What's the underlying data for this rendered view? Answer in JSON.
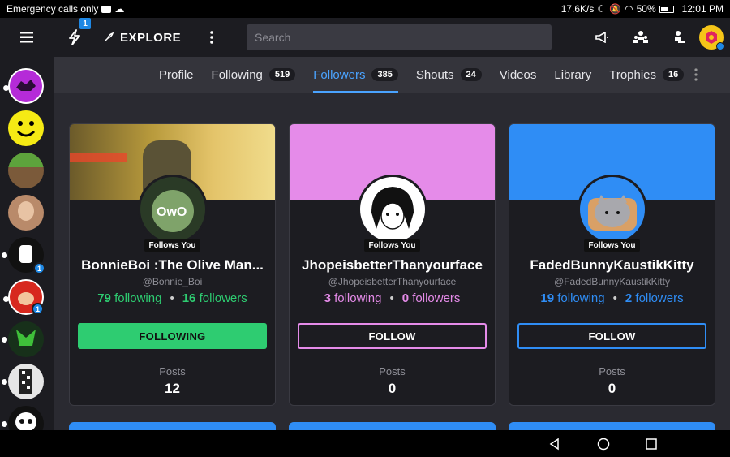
{
  "status": {
    "left_text": "Emergency calls only",
    "speed": "17.6K/s",
    "battery": "50%",
    "time": "12:01 PM"
  },
  "topbar": {
    "bolt_badge": "1",
    "explore_label": "EXPLORE",
    "search_placeholder": "Search"
  },
  "sidebar": {
    "items": [
      {
        "name": "wolf-purple",
        "badge": ""
      },
      {
        "name": "smiley",
        "badge": ""
      },
      {
        "name": "minecraft-block",
        "badge": ""
      },
      {
        "name": "person",
        "badge": ""
      },
      {
        "name": "character",
        "badge": "1"
      },
      {
        "name": "mario",
        "badge": "1"
      },
      {
        "name": "green-creature",
        "badge": ""
      },
      {
        "name": "pixel-figure",
        "badge": ""
      },
      {
        "name": "sans-skull",
        "badge": ""
      }
    ]
  },
  "tabs": [
    {
      "label": "Profile",
      "count": ""
    },
    {
      "label": "Following",
      "count": "519"
    },
    {
      "label": "Followers",
      "count": "385"
    },
    {
      "label": "Shouts",
      "count": "24"
    },
    {
      "label": "Videos",
      "count": ""
    },
    {
      "label": "Library",
      "count": ""
    },
    {
      "label": "Trophies",
      "count": "16"
    }
  ],
  "active_tab": "Followers",
  "cards": [
    {
      "follows_you": "Follows You",
      "name": "BonnieBoi :The Olive Man...",
      "handle": "@Bonnie_Boi",
      "following": "79",
      "following_label": "following",
      "followers": "16",
      "followers_label": "followers",
      "button": "FOLLOWING",
      "posts_label": "Posts",
      "posts": "12",
      "accent": "#2ecc71"
    },
    {
      "follows_you": "Follows You",
      "name": "JhopeisbetterThanyourface",
      "handle": "@JhopeisbetterThanyourface",
      "following": "3",
      "following_label": "following",
      "followers": "0",
      "followers_label": "followers",
      "button": "FOLLOW",
      "posts_label": "Posts",
      "posts": "0",
      "accent": "#e58be9"
    },
    {
      "follows_you": "Follows You",
      "name": "FadedBunnyKaustikKitty",
      "handle": "@FadedBunnyKaustikKitty",
      "following": "19",
      "following_label": "following",
      "followers": "2",
      "followers_label": "followers",
      "button": "FOLLOW",
      "posts_label": "Posts",
      "posts": "0",
      "accent": "#2f8df5"
    }
  ]
}
